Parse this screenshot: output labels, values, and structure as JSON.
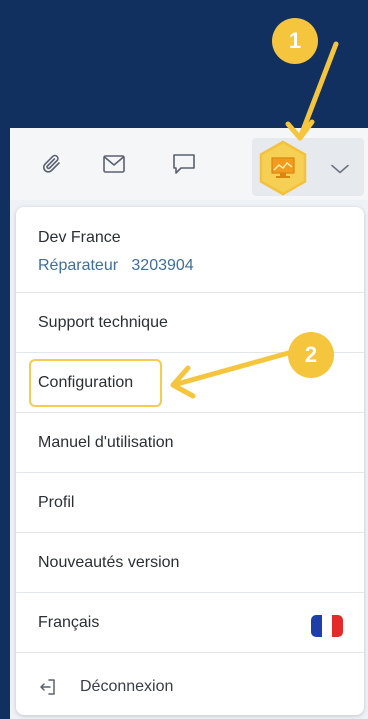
{
  "toolbar": {
    "icons": [
      "paperclip-icon",
      "envelope-icon",
      "chat-bubble-icon"
    ],
    "avatar_icon": "monitor-hexagon-icon",
    "dropdown_icon": "chevron-down-icon"
  },
  "user": {
    "name": "Dev France",
    "role": "Réparateur",
    "id": "3203904"
  },
  "menu": {
    "items": [
      {
        "label": "Support technique"
      },
      {
        "label": "Configuration"
      },
      {
        "label": "Manuel d'utilisation"
      },
      {
        "label": "Profil"
      },
      {
        "label": "Nouveautés version"
      },
      {
        "label": "Français"
      }
    ],
    "logout_label": "Déconnexion"
  },
  "annotations": {
    "step1": "1",
    "step2": "2"
  },
  "colors": {
    "background": "#12305f",
    "highlight": "#f4c53d",
    "role_text": "#3f6f9a"
  }
}
